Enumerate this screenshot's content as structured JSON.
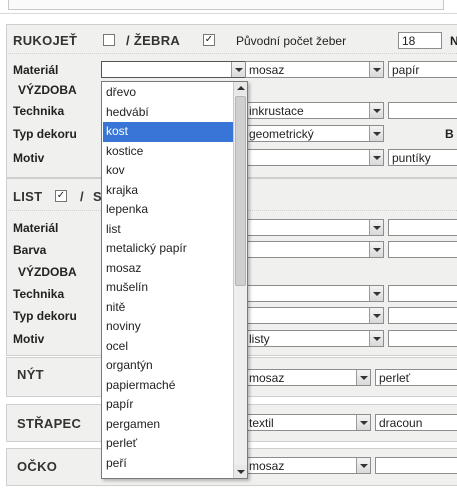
{
  "rukojet": {
    "title": "RUKOJEŤ",
    "zebra_label": "/ ŽEBRA",
    "rukojet_checked": false,
    "zebra_checked": true,
    "original_count_label": "Původní počet žeber",
    "original_count_value": "18",
    "trailing_letter": "N",
    "material_label": "Materiál",
    "material_values": [
      "",
      "mosaz",
      "papír"
    ],
    "vyzdoba_label": "VÝZDOBA",
    "technika_label": "Technika",
    "technika_value": "inkrustace",
    "typ_dekoru_label": "Typ dekoru",
    "typ_dekoru_value": "geometrický",
    "trailing_b": "B",
    "motiv_label": "Motiv",
    "motiv_value": "puntíky"
  },
  "list": {
    "title": "LIST",
    "checked": true,
    "slash": "/",
    "next_letter": "S",
    "material_label": "Materiál",
    "barva_label": "Barva",
    "vyzdoba_label": "VÝZDOBA",
    "technika_label": "Technika",
    "typ_dekoru_label": "Typ dekoru",
    "motiv_label": "Motiv",
    "motiv_value": "listy"
  },
  "nyt": {
    "title": "NÝT",
    "values": [
      "mosaz",
      "perleť"
    ]
  },
  "strapec": {
    "title": "STŘAPEC",
    "values": [
      "textil",
      "dracoun"
    ]
  },
  "ocko": {
    "title": "OČKO",
    "value": "mosaz"
  },
  "dropdown": {
    "selected": "kost",
    "options": [
      "dřevo",
      "hedvábí",
      "kost",
      "kostice",
      "kov",
      "krajka",
      "lepenka",
      "list",
      "metalický papír",
      "mosaz",
      "mušelín",
      "nitě",
      "noviny",
      "ocel",
      "organtýn",
      "papiermaché",
      "papír",
      "pergamen",
      "perleť",
      "peří"
    ]
  },
  "icons": {
    "checkbox_checked": "✓",
    "scroll_up": "arrow-up-icon",
    "scroll_down": "arrow-down-icon"
  }
}
